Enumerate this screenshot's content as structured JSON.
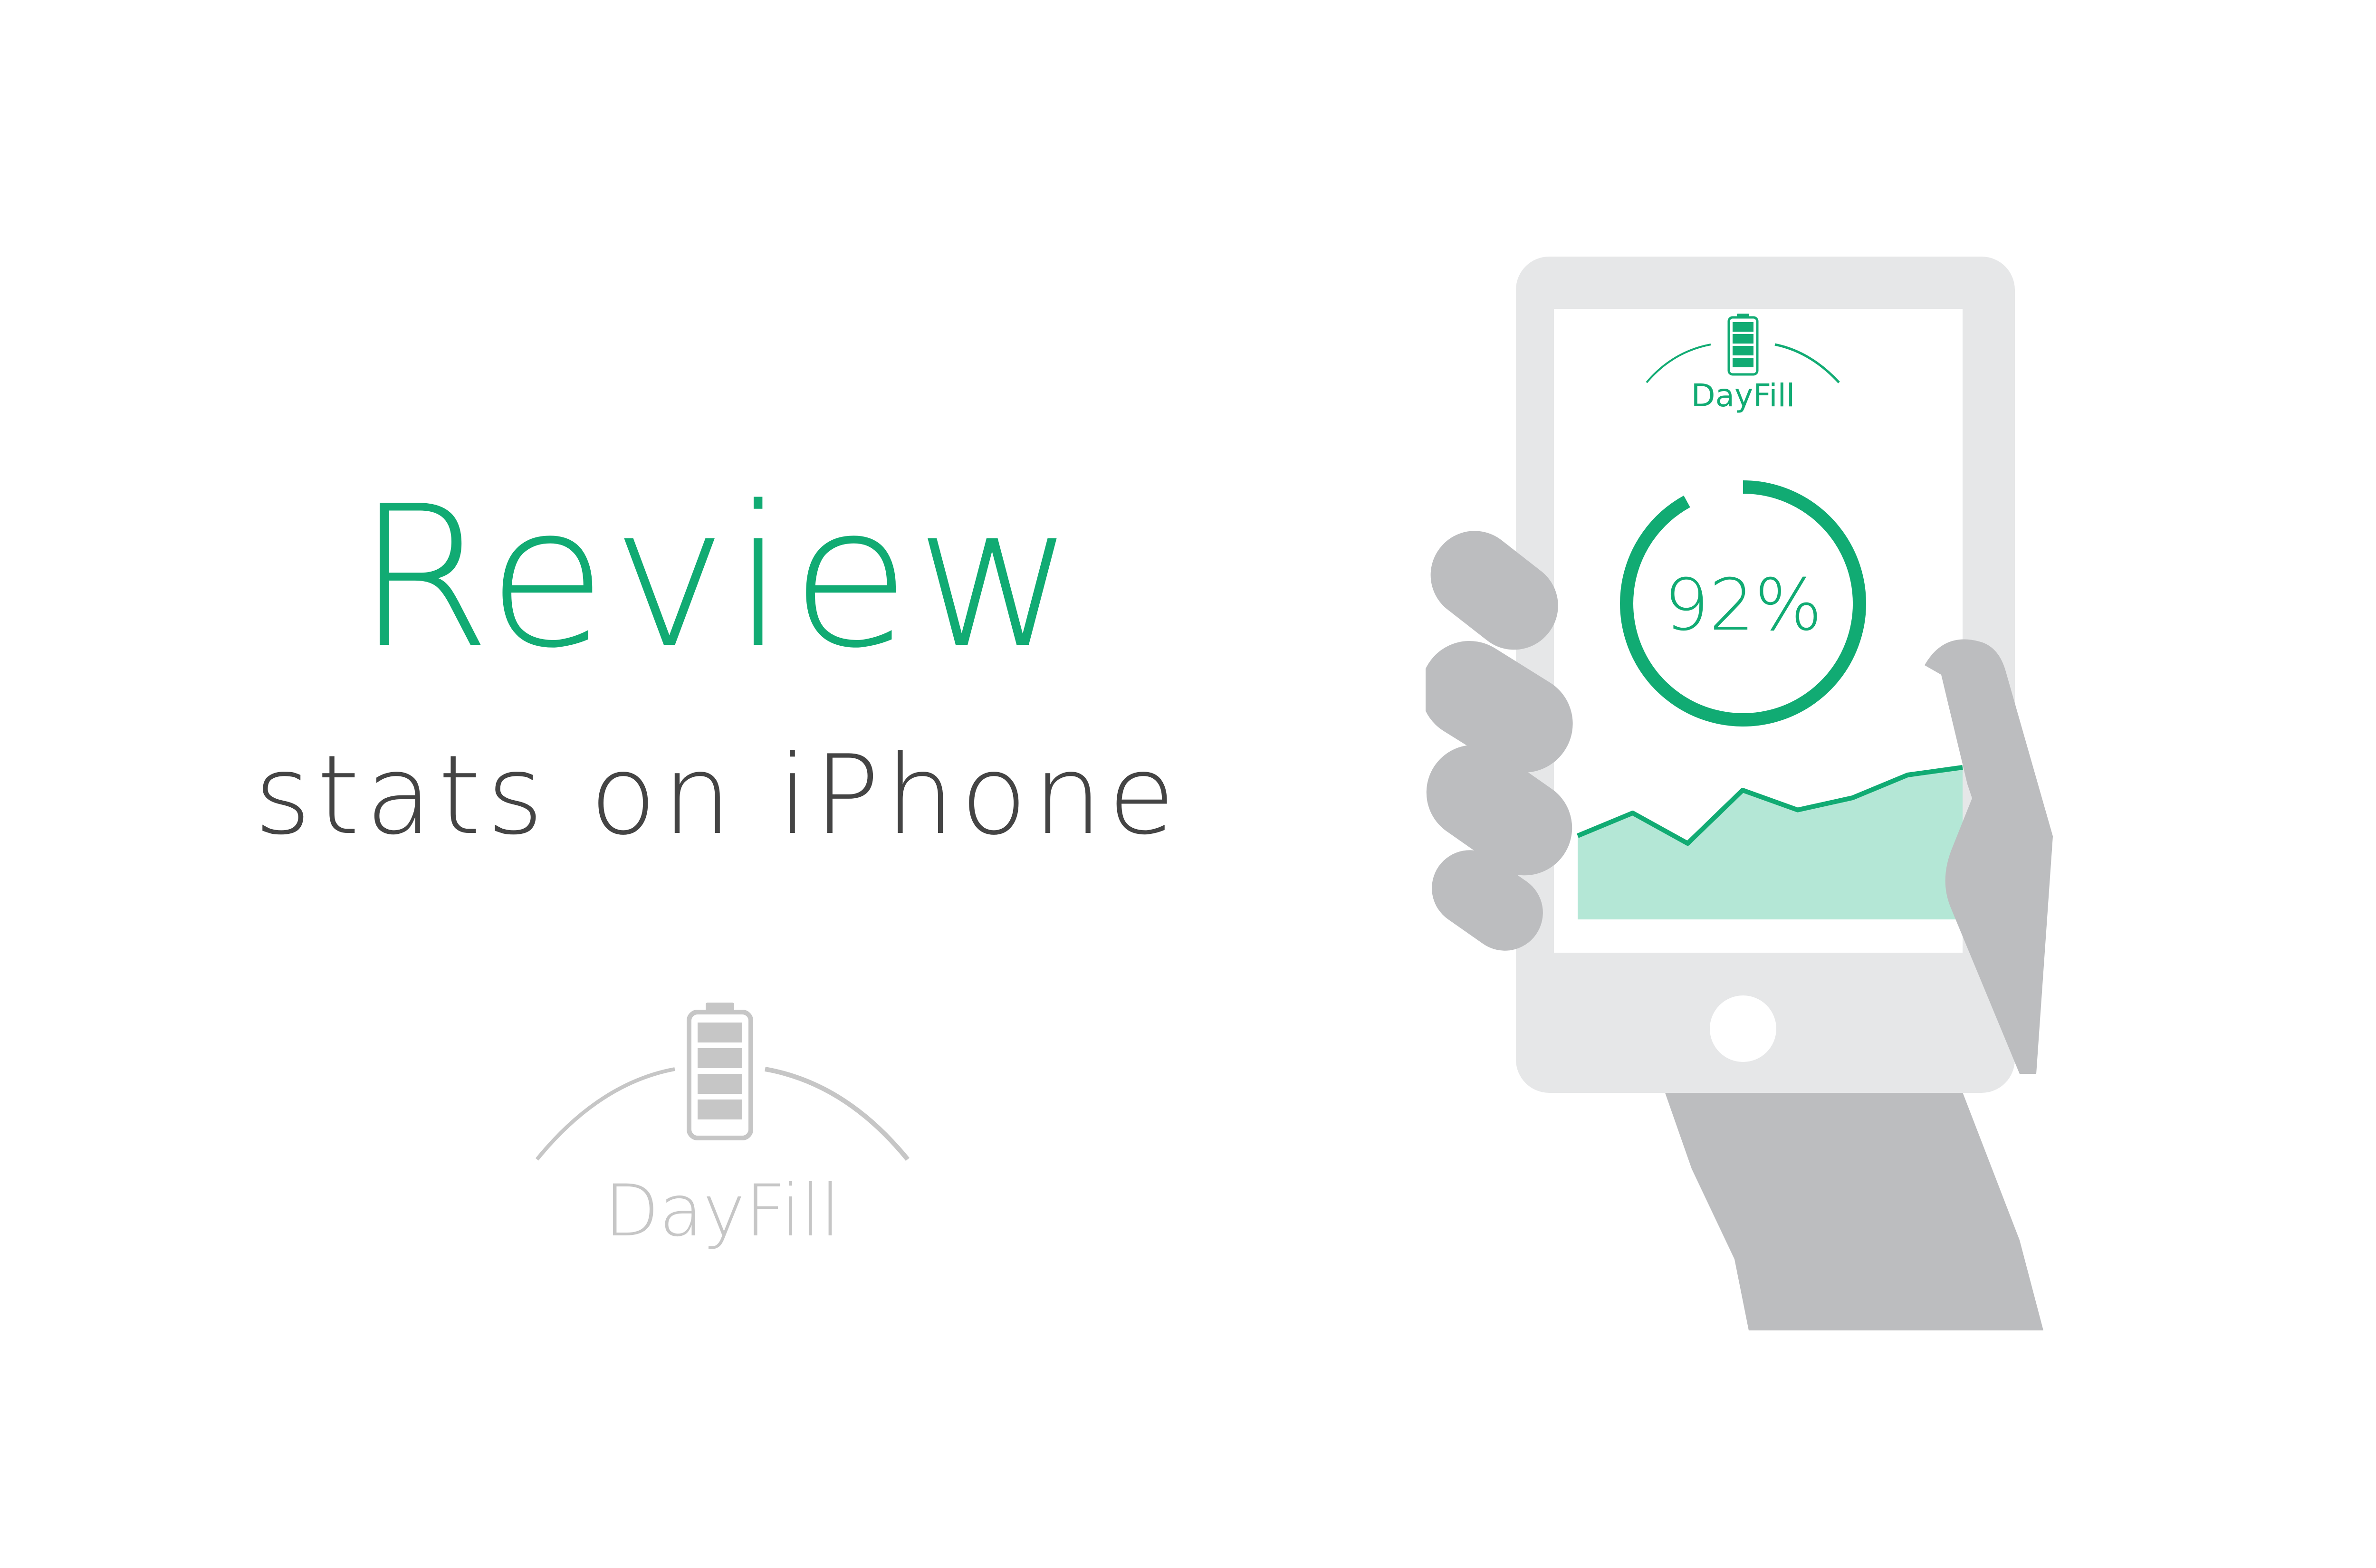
{
  "headline": {
    "title": "Review",
    "subtitle": "stats on iPhone"
  },
  "brand": {
    "name": "DayFill"
  },
  "phone_screen": {
    "logo_text": "DayFill",
    "progress_label": "92%",
    "progress_fraction": 0.92
  },
  "chart_data": {
    "type": "area",
    "values": [
      0.55,
      0.7,
      0.5,
      0.85,
      0.72,
      0.8,
      0.95,
      1.0
    ]
  },
  "colors": {
    "accent": "#11ab73",
    "accent_light": "#b4e7d6",
    "subtitle": "#444444",
    "logo_gray": "#bdbdbd",
    "phone_frame": "#e6e7e8",
    "hand": "#bcbdbf"
  }
}
